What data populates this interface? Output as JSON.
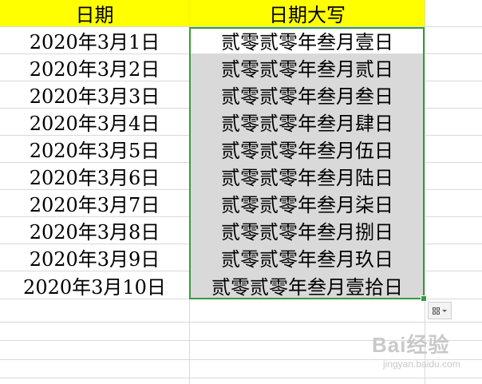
{
  "sheet": {
    "headers": [
      "日期",
      "日期大写"
    ],
    "rows": [
      [
        "2020年3月1日",
        "贰零贰零年叁月壹日"
      ],
      [
        "2020年3月2日",
        "贰零贰零年叁月贰日"
      ],
      [
        "2020年3月3日",
        "贰零贰零年叁月叁日"
      ],
      [
        "2020年3月4日",
        "贰零贰零年叁月肆日"
      ],
      [
        "2020年3月5日",
        "贰零贰零年叁月伍日"
      ],
      [
        "2020年3月6日",
        "贰零贰零年叁月陆日"
      ],
      [
        "2020年3月7日",
        "贰零贰零年叁月柒日"
      ],
      [
        "2020年3月8日",
        "贰零贰零年叁月捌日"
      ],
      [
        "2020年3月9日",
        "贰零贰零年叁月玖日"
      ],
      [
        "2020年3月10日",
        "贰零贰零年叁月壹拾日"
      ]
    ],
    "header_fill_color": "#ffff00",
    "selection_fill_color": "#d9d9d9",
    "selection_border_color": "#3a9a3a",
    "gridline_color": "#d9d9d9"
  },
  "quick_analysis": {
    "icon": "quick-analysis-icon"
  },
  "watermark": {
    "text": "Bai经验",
    "sub": "jingyan.baidu.com"
  }
}
